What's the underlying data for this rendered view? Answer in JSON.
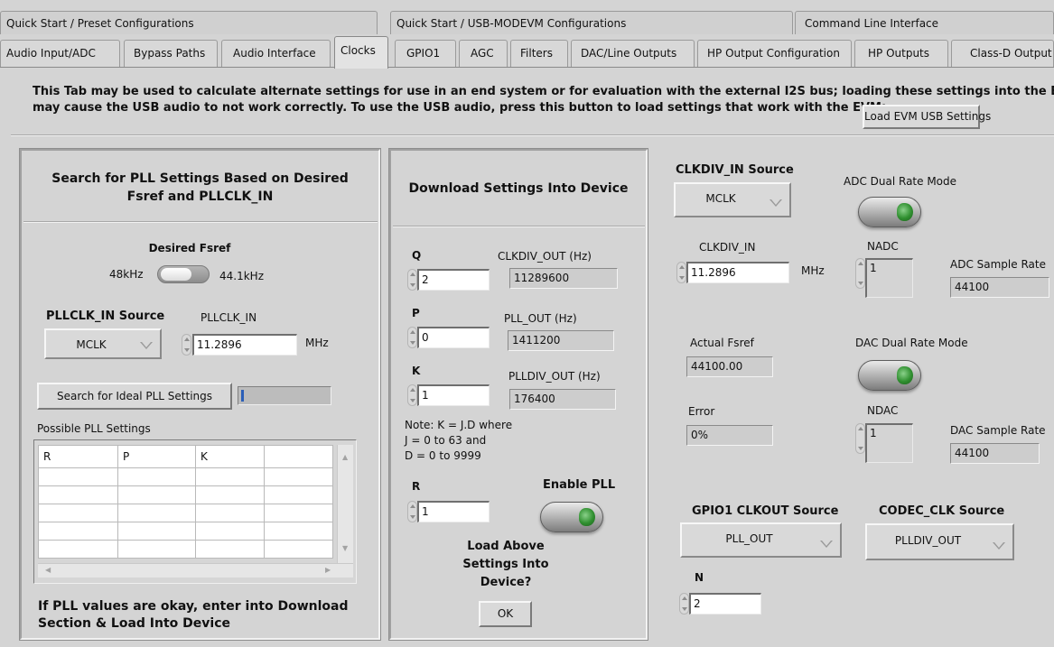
{
  "tabs_top": [
    "Quick Start / Preset Configurations",
    "Quick Start / USB-MODEVM Configurations",
    "Command Line Interface"
  ],
  "tabs": [
    "Audio Input/ADC",
    "Bypass Paths",
    "Audio Interface",
    "Clocks",
    "GPIO1",
    "AGC",
    "Filters",
    "DAC/Line Outputs",
    "HP Output Configuration",
    "HP Outputs",
    "Class-D Output"
  ],
  "active_tab": "Clocks",
  "notice": {
    "line1": "This Tab may be used to calculate alternate settings for use in an end system or for evaluation with the external I2S bus;  loading these settings into the EVM",
    "line2": "may cause  the USB audio to not work correctly.  To use the USB audio, press this button to load settings that work with the EVM:",
    "load_button": "Load EVM USB Settings"
  },
  "search": {
    "title_line1": "Search for PLL Settings Based on Desired",
    "title_line2": "Fsref and PLLCLK_IN",
    "fsref_label": "Desired Fsref",
    "fsref_left": "48kHz",
    "fsref_right": "44.1kHz",
    "source_label": "PLLCLK_IN Source",
    "source_value": "MCLK",
    "pllclk_label": "PLLCLK_IN",
    "pllclk_value": "11.2896",
    "pllclk_unit": "MHz",
    "search_button": "Search for Ideal PLL Settings",
    "search_progress": 0.02,
    "possible_label": "Possible PLL Settings",
    "columns": [
      "R",
      "P",
      "K",
      ""
    ],
    "footer_line1": "If PLL values are okay, enter into Download",
    "footer_line2": "Section & Load Into Device"
  },
  "download": {
    "title": "Download Settings Into Device",
    "q_label": "Q",
    "q_value": "2",
    "p_label": "P",
    "p_value": "0",
    "k_label": "K",
    "k_value": "1",
    "r_label": "R",
    "r_value": "1",
    "clkdiv_out_label": "CLKDIV_OUT (Hz)",
    "clkdiv_out_value": "11289600",
    "pll_out_label": "PLL_OUT (Hz)",
    "pll_out_value": "1411200",
    "plldiv_out_label": "PLLDIV_OUT (Hz)",
    "plldiv_out_value": "176400",
    "note_line1": "Note: K = J.D where",
    "note_line2": "J = 0 to 63 and",
    "note_line3": "D = 0 to 9999",
    "enable_pll_label": "Enable PLL",
    "load_q_line1": "Load Above",
    "load_q_line2": "Settings Into",
    "load_q_line3": "Device?",
    "ok_button": "OK"
  },
  "right": {
    "clkdiv_in_source_label": "CLKDIV_IN Source",
    "clkdiv_in_source_value": "MCLK",
    "adc_dual_label": "ADC Dual Rate Mode",
    "clkdiv_in_label": "CLKDIV_IN",
    "clkdiv_in_value": "11.2896",
    "clkdiv_in_unit": "MHz",
    "nadc_label": "NADC",
    "nadc_value": "1",
    "adc_rate_label": "ADC Sample Rate",
    "adc_rate_value": "44100",
    "actual_fsref_label": "Actual Fsref",
    "actual_fsref_value": "44100.00",
    "dac_dual_label": "DAC Dual Rate Mode",
    "error_label": "Error",
    "error_value": "0%",
    "ndac_label": "NDAC",
    "ndac_value": "1",
    "dac_rate_label": "DAC Sample Rate",
    "dac_rate_value": "44100",
    "gpio_label": "GPIO1 CLKOUT Source",
    "gpio_value": "PLL_OUT",
    "codec_label": "CODEC_CLK Source",
    "codec_value": "PLLDIV_OUT",
    "n_label": "N",
    "n_value": "2"
  }
}
